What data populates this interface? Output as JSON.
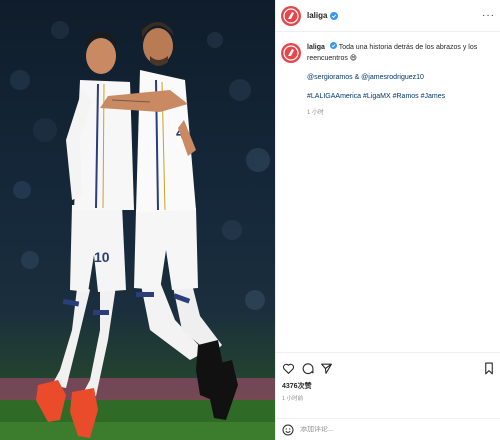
{
  "account": {
    "username": "laliga",
    "verified": true,
    "brand_color": "#e6464b"
  },
  "caption": {
    "username": "laliga",
    "text": "Toda una historia detrás de los abrazos y los reencuentros 😄",
    "mentions": "@sergioramos & @jamesrodriguez10",
    "hashtags": "#LALIGAAmerica #LigaMX #Ramos #James",
    "time": "1 小时"
  },
  "engagement": {
    "likes": "4376次赞",
    "time": "1 小时前"
  },
  "comment_box": {
    "placeholder": "添加评论..."
  },
  "photo": {
    "left_player_number": "10",
    "right_player_number": "4"
  },
  "icons": {
    "like": "heart-icon",
    "comment": "comment-icon",
    "share": "share-icon",
    "save": "bookmark-icon",
    "emoji": "emoji-icon",
    "more": "more-icon",
    "verified": "verified-badge-icon",
    "avatar": "laliga-logo-icon"
  },
  "colors": {
    "link": "#00376b",
    "verified": "#3897f0",
    "muted": "#8e8e8e"
  }
}
